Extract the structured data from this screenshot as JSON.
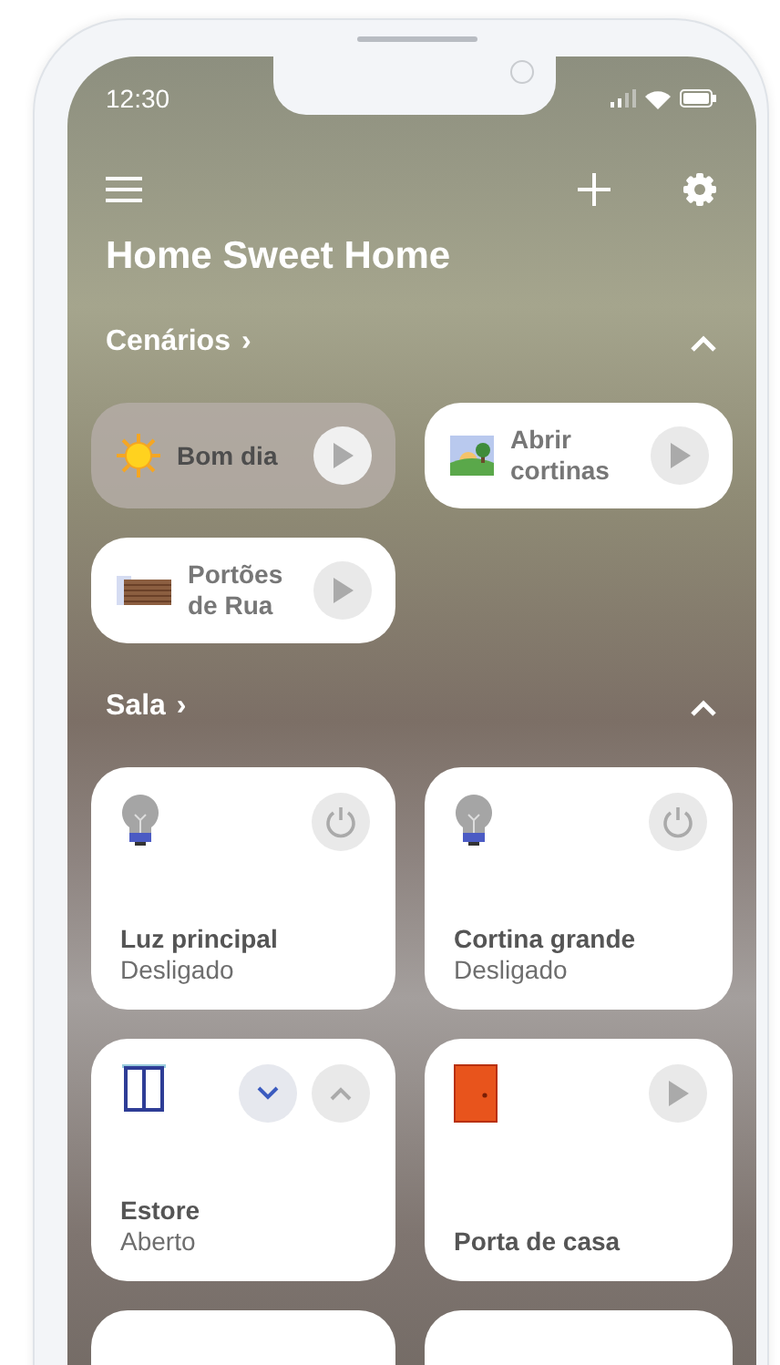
{
  "status_bar": {
    "time": "12:30"
  },
  "title": "Home Sweet Home",
  "scenes_section": {
    "title": "Cenários",
    "chevron": "›",
    "expanded": true
  },
  "scenes": [
    {
      "label": "Bom dia",
      "selected": true
    },
    {
      "label": "Abrir cortinas",
      "selected": false
    },
    {
      "label": "Portões de Rua",
      "selected": false
    }
  ],
  "room_section": {
    "title": "Sala",
    "chevron": "›",
    "expanded": true
  },
  "devices": [
    {
      "name": "Luz principal",
      "status": "Desligado",
      "kind": "switch"
    },
    {
      "name": "Cortina grande",
      "status": "Desligado",
      "kind": "switch"
    },
    {
      "name": "Estore",
      "status": "Aberto",
      "kind": "blind"
    },
    {
      "name": "Porta de casa",
      "kind": "action"
    }
  ]
}
